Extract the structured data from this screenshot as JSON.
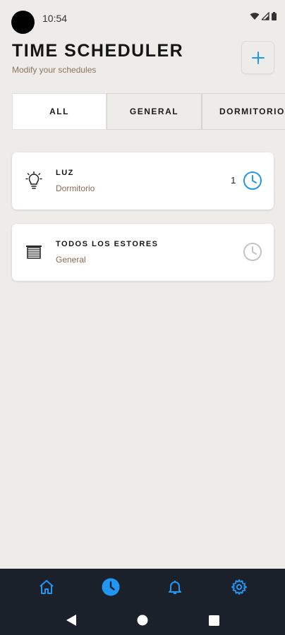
{
  "status_bar": {
    "time": "10:54",
    "icons": [
      "wifi-icon",
      "signal-icon",
      "battery-icon"
    ]
  },
  "header": {
    "title": "TIME SCHEDULER",
    "subtitle": "Modify your schedules",
    "add_icon": "plus-icon"
  },
  "tabs": [
    {
      "label": "ALL",
      "active": true
    },
    {
      "label": "GENERAL",
      "active": false
    },
    {
      "label": "DORMITORIO",
      "active": false
    }
  ],
  "devices": [
    {
      "name": "LUZ",
      "room": "Dormitorio",
      "count": "1",
      "icon": "lightbulb-icon",
      "schedule_active": true
    },
    {
      "name": "TODOS LOS ESTORES",
      "room": "General",
      "count": "",
      "icon": "blinds-icon",
      "schedule_active": false
    }
  ],
  "bottom_nav": {
    "items": [
      "home-icon",
      "clock-icon",
      "bell-icon",
      "gear-icon"
    ],
    "active": "clock-icon"
  },
  "system_nav": [
    "back-icon",
    "home-circle-icon",
    "recents-icon"
  ],
  "colors": {
    "background": "#eeece8",
    "accent": "#2196f3",
    "muted_brown": "#8c6a52",
    "nav_bg": "#1b212b",
    "inactive_clock": "#c4c4c4"
  }
}
